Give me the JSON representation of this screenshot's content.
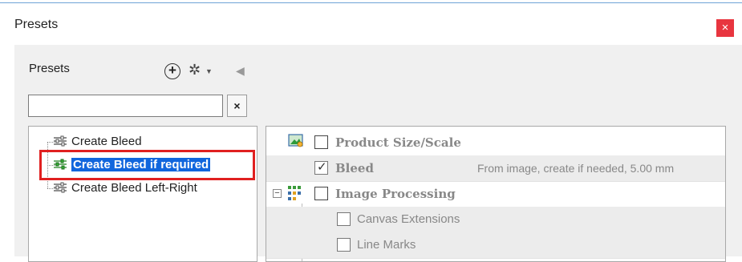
{
  "window": {
    "title": "Presets",
    "close_label": "×"
  },
  "presets_panel": {
    "label": "Presets",
    "search": {
      "value": "",
      "placeholder": ""
    },
    "clear_label": "×",
    "items": [
      {
        "label": "Create Bleed",
        "selected": false
      },
      {
        "label": "Create Bleed if required",
        "selected": true
      },
      {
        "label": "Create Bleed Left-Right",
        "selected": false
      }
    ]
  },
  "options": {
    "rows": [
      {
        "label": "Product Size/Scale",
        "checked": false,
        "value": ""
      },
      {
        "label": "Bleed",
        "checked": true,
        "value": "From image, create if needed, 5.00 mm"
      },
      {
        "label": "Image Processing",
        "checked": false,
        "value": ""
      },
      {
        "label": "Canvas Extensions",
        "checked": false,
        "value": ""
      },
      {
        "label": "Line Marks",
        "checked": false,
        "value": ""
      }
    ]
  },
  "colors": {
    "selection": "#1166dd",
    "highlight": "#e02020",
    "close": "#e8353f"
  }
}
